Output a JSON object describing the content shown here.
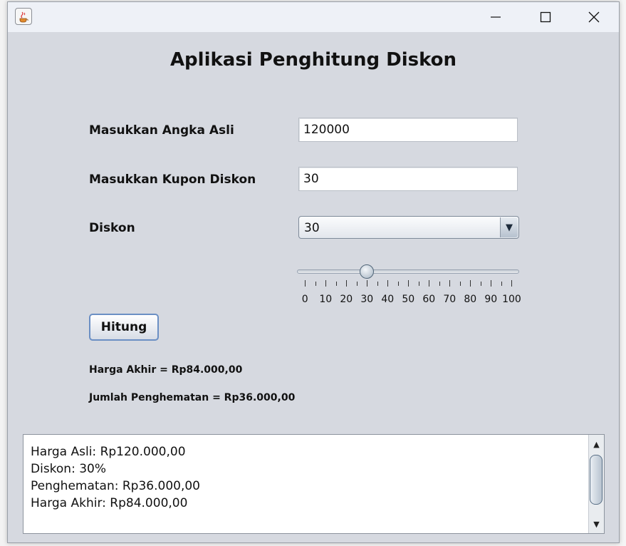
{
  "window": {
    "title": "Aplikasi Penghitung Diskon"
  },
  "form": {
    "angka_asli_label": "Masukkan Angka Asli",
    "angka_asli_value": "120000",
    "kupon_label": "Masukkan Kupon Diskon",
    "kupon_value": "30",
    "diskon_label": "Diskon",
    "diskon_selected": "30",
    "slider": {
      "value": 30,
      "min": 0,
      "max": 100,
      "tick_labels": [
        "0",
        "10",
        "20",
        "30",
        "40",
        "50",
        "60",
        "70",
        "80",
        "90",
        "100"
      ]
    },
    "hitung_label": "Hitung"
  },
  "results": {
    "harga_akhir": "Harga Akhir = Rp84.000,00",
    "jumlah_penghematan": "Jumlah Penghematan = Rp36.000,00"
  },
  "output_lines": [
    "Harga Asli: Rp120.000,00",
    "Diskon: 30%",
    "Penghematan: Rp36.000,00",
    "Harga Akhir: Rp84.000,00"
  ],
  "icons": {
    "app": "java-coffee-icon",
    "minimize": "minimize-icon",
    "maximize": "maximize-icon",
    "close": "close-icon"
  }
}
